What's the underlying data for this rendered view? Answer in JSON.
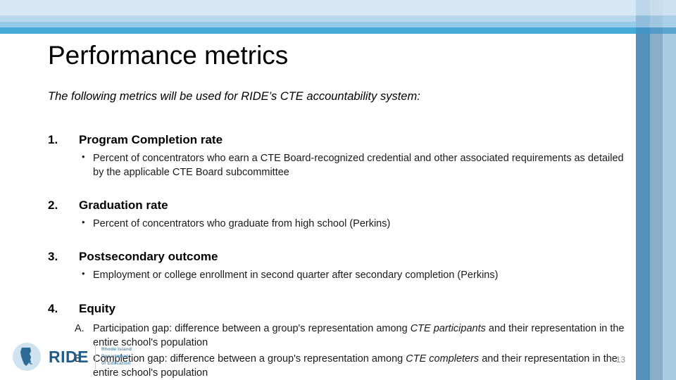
{
  "slide": {
    "title": "Performance metrics",
    "subtitle": "The following metrics will be used for RIDE’s CTE accountability system:",
    "page_number": "13"
  },
  "theme": {
    "band_pale": "#d6e7f5",
    "band_light": "#b9d8ef",
    "band_mid": "#97c9e8",
    "band_accent": "#45aad6",
    "bar_dark": "#5391bb",
    "bar_mid": "#8cadc6",
    "bar_light": "#a8cbdf",
    "logo_blue": "#1f5d88",
    "page_number_gray": "#8d8d8d"
  },
  "metrics": [
    {
      "number": "1.",
      "title": "Program Completion rate",
      "bullets": [
        "Percent of concentrators who earn a CTE Board-recognized credential and other associated requirements as detailed by the applicable CTE Board subcommittee"
      ]
    },
    {
      "number": "2.",
      "title": "Graduation rate",
      "bullets": [
        "Percent of concentrators who graduate from high school (Perkins)"
      ]
    },
    {
      "number": "3.",
      "title": "Postsecondary outcome",
      "bullets": [
        "Employment or college enrollment in second quarter after secondary completion (Perkins)"
      ]
    },
    {
      "number": "4.",
      "title": "Equity",
      "bullets": [],
      "sub_items": [
        {
          "label": "A.",
          "text_before": "Participation gap: difference between a group's representation among ",
          "emphasis": "CTE participants",
          "text_after": " and their representation in the entire school's population"
        },
        {
          "label": "B.",
          "text_before": "Completion gap: difference between a group's representation among ",
          "emphasis": "CTE completers",
          "text_after": " and their representation in the entire school's population"
        }
      ]
    }
  ],
  "logo": {
    "wordmark": "RIDE",
    "line1": "Rhode Island",
    "line2": "Department",
    "line3": "of Education"
  }
}
